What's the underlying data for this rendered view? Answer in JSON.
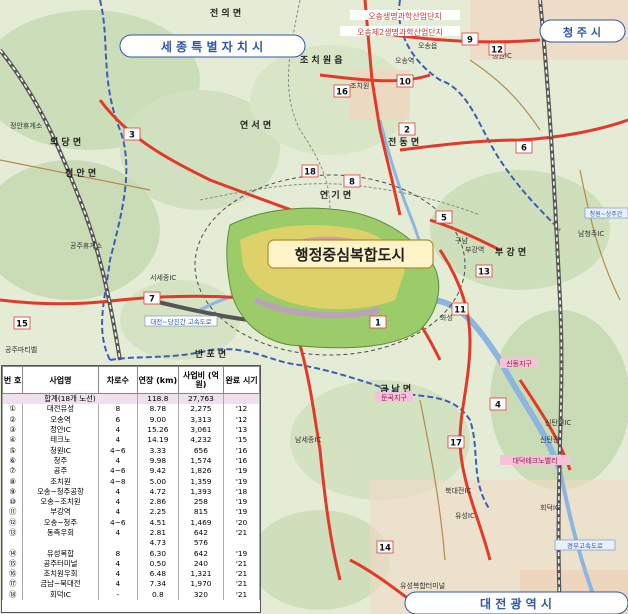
{
  "map": {
    "title": "행정중심복합도시",
    "labels": {
      "sejong_city": "세 종 특 별 자 치 시",
      "cheongju_city": "청 주 시",
      "daejeon_city": "대 전 광 역 시",
      "osong_industrial": "오송생명과학산업단지",
      "osong2_industrial": "오송제2생명과학산업단지",
      "cheongwon_ic": "청원IC",
      "osong_station": "오송역",
      "jochiwon": "조치원",
      "jochiwon_eup": "조 치 원 읍",
      "jeonui": "전 의 면",
      "jeondong": "전 동 면",
      "yeonseo": "연 서 면",
      "jeondong2": "전 동 면",
      "uidang": "의 당 면",
      "jeongan": "정 안 면",
      "yeongi": "연 기 면",
      "bugang": "부 강 면",
      "geumnam": "금 남 면",
      "banpo": "반 포 면",
      "jangseong": "장 군 면",
      "jeongan_ic": "정안휴게소",
      "gongju_ic": "공주휴게소",
      "seose_ic": "서세종IC",
      "gongju_shop": "공주마티벨",
      "expressway": "대전~당진간 고속도로",
      "cheongwon_sangju": "청원~상주간",
      "namicheon_ic": "남청주IC",
      "buganc_station": "부강역",
      "sintan_jigu": "신동지구",
      "dunkok_jigu": "둔곡지구",
      "daedeok_tech": "대덕테크노밸리",
      "yuseong_ic": "유성IC",
      "bukdaejeon_ic": "북대전IC",
      "sintanjin_ic": "신탄진IC",
      "hoedeok_ic": "회덕IC",
      "gyeongbu": "경부고속도로",
      "nam_sejong_ic": "남세종IC",
      "yuseong_complex": "유성복합터미널",
      "sintanjin": "신탄진",
      "gumam": "구남",
      "hwaseong": "화성",
      "osong_eup": "오송읍"
    },
    "route_numbers": [
      "1",
      "2",
      "3",
      "4",
      "5",
      "6",
      "7",
      "8",
      "9",
      "10",
      "11",
      "12",
      "13",
      "14",
      "15",
      "16",
      "17",
      "18"
    ]
  },
  "table": {
    "headers": [
      "번 호",
      "사업명",
      "차로수",
      "연장 (km)",
      "사업비 (억원)",
      "완료 시기"
    ],
    "total": {
      "label": "합계(18개 노선)",
      "length": "118.8",
      "cost": "27,763"
    },
    "rows": [
      [
        "①",
        "대전유성",
        "8",
        "8.78",
        "2,275",
        "'12"
      ],
      [
        "②",
        "오송역",
        "6",
        "9.00",
        "3,313",
        "'12"
      ],
      [
        "③",
        "정안IC",
        "4",
        "15.26",
        "3,061",
        "'13"
      ],
      [
        "④",
        "테크노",
        "4",
        "14.19",
        "4,232",
        "'15"
      ],
      [
        "⑤",
        "청원IC",
        "4~6",
        "3.33",
        "656",
        "'16"
      ],
      [
        "⑥",
        "청주",
        "4",
        "9.98",
        "1,574",
        "'16"
      ],
      [
        "⑦",
        "공주",
        "4~6",
        "9.42",
        "1,826",
        "'19"
      ],
      [
        "⑧",
        "조치원",
        "4~8",
        "5.00",
        "1,359",
        "'19"
      ],
      [
        "⑨",
        "오송~청주공항",
        "4",
        "4.72",
        "1,393",
        "'18"
      ],
      [
        "⑩",
        "오송~조치원",
        "4",
        "2.86",
        "258",
        "'19"
      ],
      [
        "⑪",
        "부강역",
        "4",
        "2.25",
        "815",
        "'19"
      ],
      [
        "⑫",
        "오송~청주",
        "4~6",
        "4.51",
        "1,469",
        "'20"
      ],
      [
        "⑬",
        "동측우회",
        "4",
        "2.81",
        "642",
        "'21"
      ],
      [
        "",
        "",
        "",
        "4.73",
        "576",
        ""
      ],
      [
        "⑭",
        "유성복합",
        "8",
        "6.30",
        "642",
        "'19"
      ],
      [
        "⑮",
        "공주터미널",
        "4",
        "0.50",
        "240",
        "'21"
      ],
      [
        "⑯",
        "조치원우회",
        "4",
        "6.48",
        "1,321",
        "'21"
      ],
      [
        "⑰",
        "금남~북대전",
        "4",
        "7.34",
        "1,970",
        "'21"
      ],
      [
        "⑱",
        "회덕IC",
        "-",
        "0.8",
        "320",
        "'21"
      ]
    ]
  }
}
